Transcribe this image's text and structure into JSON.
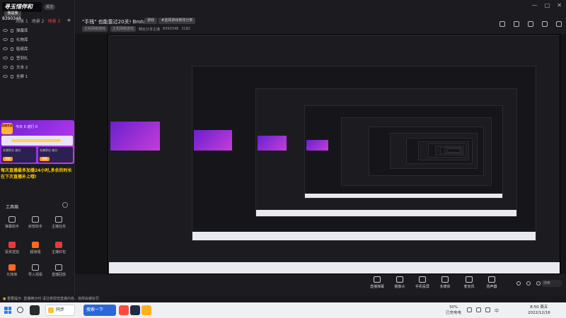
{
  "app": {
    "logo_text": "寻玉惜伴和",
    "logo_sub": "我是我",
    "follow_tag": "关注",
    "room_id": "8390348"
  },
  "scenes": {
    "tabs": [
      "场景 1",
      "场景 2",
      "场景 3"
    ],
    "active_index": 2,
    "add_label": "+"
  },
  "layers": [
    "弹幕库",
    "礼物库",
    "贴纸库",
    "签到礼",
    "文本 2",
    "全屏 1"
  ],
  "promo": {
    "badge_text": "直播奖励",
    "count_text": "今日 0   进行 0",
    "card_left": "礼物积分 加分",
    "card_right": "礼物积分 加分",
    "card_btn": "领取"
  },
  "yellow_note": "每次直播最多加播24小时,多余的时长在下次直播补上哦!",
  "toolbox": {
    "title": "工具箱",
    "items": [
      {
        "label": "弹幕助手",
        "style": "outline"
      },
      {
        "label": "房管助手",
        "style": "outline"
      },
      {
        "label": "主播任务",
        "style": "outline"
      },
      {
        "label": "投资送拍",
        "style": "red"
      },
      {
        "label": "超级福",
        "style": "orange"
      },
      {
        "label": "主播红包",
        "style": "red"
      },
      {
        "label": "礼物库",
        "style": "orange"
      },
      {
        "label": "导入观看",
        "style": "outline"
      },
      {
        "label": "直播回放",
        "style": "outline"
      }
    ]
  },
  "header": {
    "title": "\"手残\" 也能靠过20关! Brotato!",
    "category_tag": "游戏",
    "rename_tag": "#选择游戏修改分类",
    "subline_chips": [
      "主机网络游戏",
      "主机网络游戏"
    ],
    "subline_stats": [
      "畅玩分享主播",
      "8390348",
      "3182"
    ],
    "window_controls": [
      "—",
      "□",
      "✕"
    ]
  },
  "controls": [
    {
      "label": "直播弹幕"
    },
    {
      "label": "摄像头"
    },
    {
      "label": "手机投屏"
    },
    {
      "label": "多媒体"
    },
    {
      "label": "麦克风"
    },
    {
      "label": "扬声器"
    }
  ],
  "controls_search": "搜索",
  "notice": "重要提示: 直播倒计时 请注意规范直播内容，违规会被处罚",
  "taskbar": {
    "task_label": "同步",
    "input_label": "搜索一下",
    "battery_pct": "30%",
    "battery_state": "已充电电",
    "clock_time": "8:50 周五",
    "clock_date": "2022/12/16",
    "tray_lang": "中"
  },
  "colors": {
    "accent": "#ff3d55",
    "promo_purple": "#8a2be2",
    "warning_yellow": "#ffcc00",
    "taskbar_blue": "#2a67d8"
  }
}
